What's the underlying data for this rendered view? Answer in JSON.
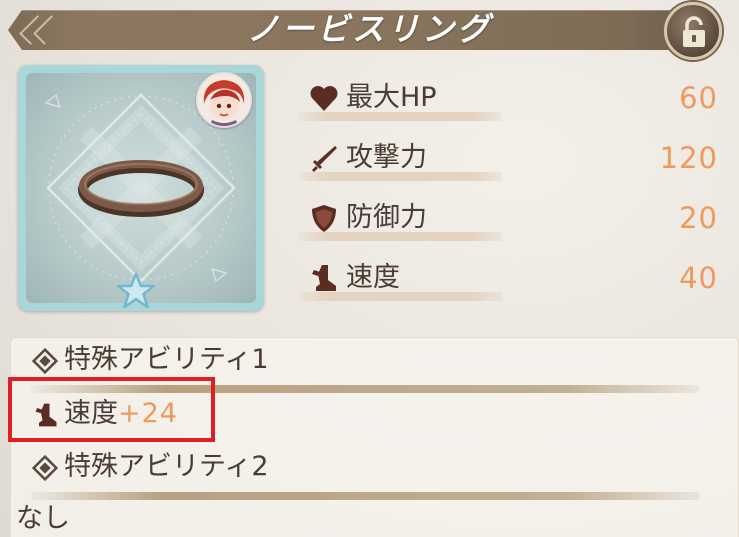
{
  "header": {
    "item_name": "ノービスリング"
  },
  "stats": [
    {
      "icon": "heart-icon",
      "label": "最大HP",
      "value": "60"
    },
    {
      "icon": "sword-icon",
      "label": "攻撃力",
      "value": "120"
    },
    {
      "icon": "shield-icon",
      "label": "防御力",
      "value": "20"
    },
    {
      "icon": "boot-icon",
      "label": "速度",
      "value": "40"
    }
  ],
  "abilities": {
    "slot1_title": "特殊アビリティ1",
    "slot1_effect_label": "速度",
    "slot1_effect_value": "+24",
    "slot2_title": "特殊アビリティ2",
    "slot2_effect": "なし"
  },
  "item": {
    "rarity_stars": 1
  },
  "colors": {
    "accent_value": "#ef9a5c",
    "highlight": "#e01e25",
    "card_frame": "#a8d6d9"
  }
}
